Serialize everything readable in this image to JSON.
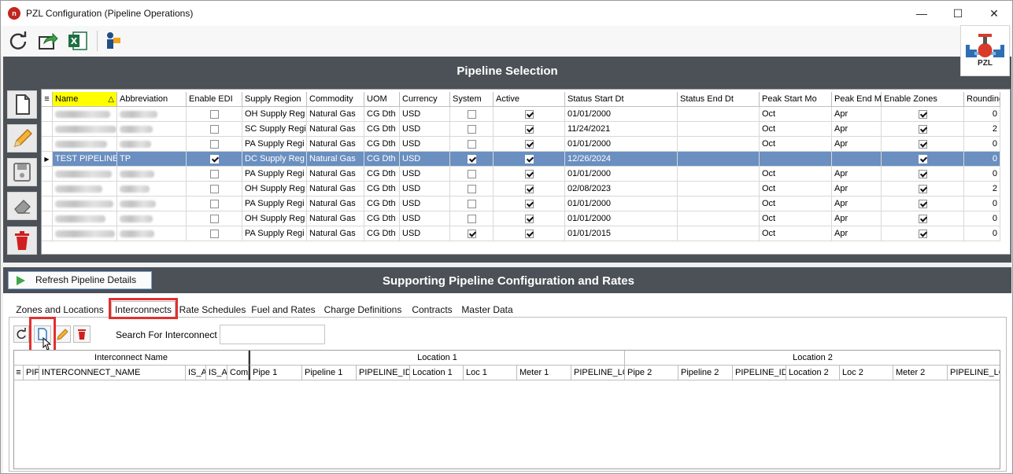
{
  "window": {
    "title": "PZL Configuration (Pipeline Operations)",
    "logo_text": "PZL"
  },
  "toolbar": {
    "icons": [
      "refresh-icon",
      "export-icon",
      "excel-icon",
      "user-config-icon"
    ]
  },
  "pipeline_selection": {
    "title": "Pipeline Selection",
    "side_buttons": [
      "new-icon",
      "edit-icon",
      "save-icon",
      "eraser-icon",
      "delete-icon"
    ],
    "columns": [
      "Name",
      "Abbreviation",
      "Enable EDI",
      "Supply Region",
      "Commodity",
      "UOM",
      "Currency",
      "System",
      "Active",
      "Status Start Dt",
      "Status End Dt",
      "Peak Start Mo",
      "Peak End Mo",
      "Enable Zones",
      "Rounding"
    ],
    "rows": [
      {
        "name": "",
        "abbr": "",
        "edi": false,
        "region": "OH Supply Reg",
        "commodity": "Natural Gas",
        "uom": "CG Dth",
        "currency": "USD",
        "system": false,
        "active": true,
        "start": "01/01/2000",
        "end": "",
        "peak_start": "Oct",
        "peak_end": "Apr",
        "zones": true,
        "rounding": "0",
        "selected": false
      },
      {
        "name": "",
        "abbr": "",
        "edi": false,
        "region": "SC Supply Regi",
        "commodity": "Natural Gas",
        "uom": "CG Dth",
        "currency": "USD",
        "system": false,
        "active": true,
        "start": "11/24/2021",
        "end": "",
        "peak_start": "Oct",
        "peak_end": "Apr",
        "zones": true,
        "rounding": "2",
        "selected": false
      },
      {
        "name": "",
        "abbr": "",
        "edi": false,
        "region": "PA Supply Regi",
        "commodity": "Natural Gas",
        "uom": "CG Dth",
        "currency": "USD",
        "system": false,
        "active": true,
        "start": "01/01/2000",
        "end": "",
        "peak_start": "Oct",
        "peak_end": "Apr",
        "zones": true,
        "rounding": "0",
        "selected": false
      },
      {
        "name": "TEST PIPELINE",
        "abbr": "TP",
        "edi": true,
        "region": "DC Supply Reg",
        "commodity": "Natural Gas",
        "uom": "CG Dth",
        "currency": "USD",
        "system": true,
        "active": true,
        "start": "12/26/2024",
        "end": "",
        "peak_start": "",
        "peak_end": "",
        "zones": true,
        "rounding": "0",
        "selected": true
      },
      {
        "name": "",
        "abbr": "",
        "edi": false,
        "region": "PA Supply Regi",
        "commodity": "Natural Gas",
        "uom": "CG Dth",
        "currency": "USD",
        "system": false,
        "active": true,
        "start": "01/01/2000",
        "end": "",
        "peak_start": "Oct",
        "peak_end": "Apr",
        "zones": true,
        "rounding": "0",
        "selected": false
      },
      {
        "name": "",
        "abbr": "",
        "edi": false,
        "region": "OH Supply Reg",
        "commodity": "Natural Gas",
        "uom": "CG Dth",
        "currency": "USD",
        "system": false,
        "active": true,
        "start": "02/08/2023",
        "end": "",
        "peak_start": "Oct",
        "peak_end": "Apr",
        "zones": true,
        "rounding": "2",
        "selected": false
      },
      {
        "name": "",
        "abbr": "",
        "edi": false,
        "region": "PA Supply Regi",
        "commodity": "Natural Gas",
        "uom": "CG Dth",
        "currency": "USD",
        "system": false,
        "active": true,
        "start": "01/01/2000",
        "end": "",
        "peak_start": "Oct",
        "peak_end": "Apr",
        "zones": true,
        "rounding": "0",
        "selected": false
      },
      {
        "name": "",
        "abbr": "",
        "edi": false,
        "region": "OH Supply Reg",
        "commodity": "Natural Gas",
        "uom": "CG Dth",
        "currency": "USD",
        "system": false,
        "active": true,
        "start": "01/01/2000",
        "end": "",
        "peak_start": "Oct",
        "peak_end": "Apr",
        "zones": true,
        "rounding": "0",
        "selected": false
      },
      {
        "name": "",
        "abbr": "",
        "edi": false,
        "region": "PA Supply Regi",
        "commodity": "Natural Gas",
        "uom": "CG Dth",
        "currency": "USD",
        "system": true,
        "active": true,
        "start": "01/01/2015",
        "end": "",
        "peak_start": "Oct",
        "peak_end": "Apr",
        "zones": true,
        "rounding": "0",
        "selected": false
      }
    ]
  },
  "supporting": {
    "refresh_label": "Refresh Pipeline Details",
    "title": "Supporting Pipeline Configuration and Rates",
    "tabs": [
      "Zones and Locations",
      "Interconnects",
      "Rate Schedules",
      "Fuel and Rates",
      "Charge Definitions",
      "Contracts",
      "Master Data"
    ],
    "active_tab": "Interconnects",
    "search_label": "Search For Interconnect",
    "search_value": "",
    "groups": [
      "Interconnect Name",
      "Location 1",
      "Location 2"
    ],
    "columns": [
      "PIP",
      "INTERCONNECT_NAME",
      "IS_A",
      "IS_A",
      "Com",
      "Pipe 1",
      "Pipeline 1",
      "PIPELINE_ID",
      "Location 1",
      "Loc 1",
      "Meter 1",
      "PIPELINE_LO",
      "Pipe 2",
      "Pipeline 2",
      "PIPELINE_ID",
      "Location 2",
      "Loc 2",
      "Meter 2",
      "PIPELINE_LO"
    ]
  },
  "colors": {
    "dark_band": "#4b5157",
    "selection": "#6a8fc0",
    "highlight": "#e0302f",
    "sort_header": "#ffff00"
  }
}
